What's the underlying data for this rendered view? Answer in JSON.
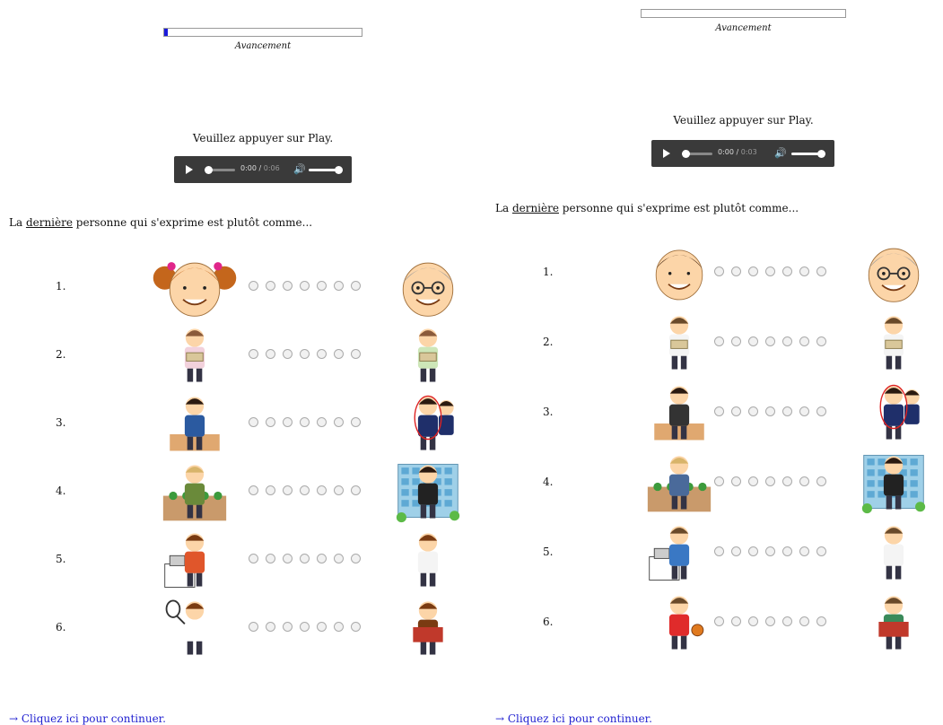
{
  "panels": [
    {
      "progress_label": "Avancement",
      "progress_value": 0.02,
      "instruction": "Veuillez appuyer sur Play.",
      "audio": {
        "current": "0:00",
        "duration": "0:06"
      },
      "question": {
        "prefix": "La ",
        "emphasis": "dernière",
        "suffix": " personne qui s'exprime est plutôt comme..."
      },
      "rows": [
        {
          "number": "1.",
          "left_image": "girl-face-pigtails-icon",
          "right_image": "elderly-woman-face-icon"
        },
        {
          "number": "2.",
          "left_image": "woman-holding-purse-icon",
          "right_image": "woman-holding-money-icon"
        },
        {
          "number": "3.",
          "left_image": "student-at-desk-icon",
          "right_image": "schoolgirls-chatting-icon"
        },
        {
          "number": "4.",
          "left_image": "farmer-in-field-icon",
          "right_image": "office-worker-building-icon"
        },
        {
          "number": "5.",
          "left_image": "cashier-at-counter-icon",
          "right_image": "doctor-woman-icon"
        },
        {
          "number": "6.",
          "left_image": "tennis-player-icon",
          "right_image": "woman-reading-book-icon"
        }
      ],
      "continue_link": "→ Cliquez ici pour continuer."
    },
    {
      "progress_label": "Avancement",
      "progress_value": 0.0,
      "instruction": "Veuillez appuyer sur Play.",
      "audio": {
        "current": "0:00",
        "duration": "0:03"
      },
      "question": {
        "prefix": "La ",
        "emphasis": "dernière",
        "suffix": " personne qui s'exprime est plutôt comme..."
      },
      "rows": [
        {
          "number": "1.",
          "left_image": "young-man-face-icon",
          "right_image": "elderly-man-face-icon"
        },
        {
          "number": "2.",
          "left_image": "worried-man-empty-wallet-icon",
          "right_image": "man-holding-money-icon"
        },
        {
          "number": "3.",
          "left_image": "student-boy-at-desk-icon",
          "right_image": "schoolboys-chatting-icon"
        },
        {
          "number": "4.",
          "left_image": "male-farmer-in-field-icon",
          "right_image": "male-office-worker-building-icon"
        },
        {
          "number": "5.",
          "left_image": "male-cashier-at-counter-icon",
          "right_image": "doctor-man-icon"
        },
        {
          "number": "6.",
          "left_image": "basketball-player-icon",
          "right_image": "man-reading-book-icon"
        }
      ],
      "continue_link": "→ Cliquez ici pour continuer."
    }
  ],
  "scale_points": 7,
  "colors": {
    "progress_fill": "#1a1adb",
    "link": "#1f1fd0",
    "player_bg": "#3a3a3a"
  }
}
